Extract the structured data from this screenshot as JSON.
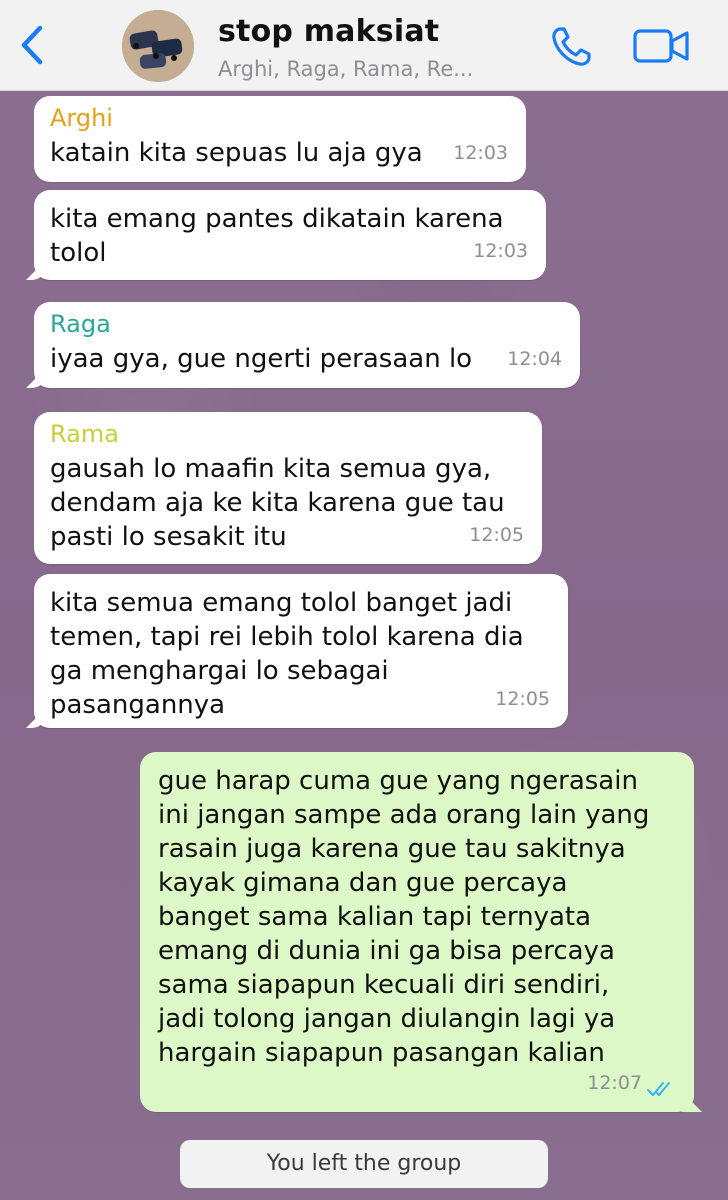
{
  "header": {
    "title": "stop maksiat",
    "subtitle": "Arghi, Raga, Rama, Re..."
  },
  "messages": [
    {
      "sender": "Arghi",
      "sender_color": "#e0a21a",
      "text": "katain kita sepuas lu aja gya",
      "time": "12:03",
      "direction": "in"
    },
    {
      "sender": "",
      "text": "kita emang pantes dikatain karena\ntolol",
      "time": "12:03",
      "direction": "in"
    },
    {
      "sender": "Raga",
      "sender_color": "#2aa59a",
      "text": "iyaa gya, gue ngerti perasaan lo",
      "time": "12:04",
      "direction": "in"
    },
    {
      "sender": "Rama",
      "sender_color": "#c7cf3c",
      "text": "gausah lo maafin kita semua gya,\ndendam aja ke kita karena gue tau\npasti lo sesakit itu",
      "time": "12:05",
      "direction": "in"
    },
    {
      "sender": "",
      "text": "kita semua emang tolol banget jadi\ntemen, tapi rei lebih tolol karena dia\nga menghargai lo sebagai\npasangannya",
      "time": "12:05",
      "direction": "in"
    },
    {
      "sender": "",
      "text": "gue harap cuma gue yang ngerasain\nini jangan sampe ada orang lain yang\nrasain juga karena gue tau sakitnya\nkayak gimana dan gue percaya\nbanget sama kalian tapi ternyata\nemang di dunia ini ga bisa percaya\nsama siapapun kecuali diri sendiri,\njadi tolong jangan diulangin lagi ya\nhargain siapapun pasangan kalian",
      "time": "12:07",
      "direction": "out",
      "status": "read"
    }
  ],
  "system_message": "You left the group",
  "colors": {
    "accent": "#1a7cf5",
    "outgoing_bubble": "#dcf8c6",
    "incoming_bubble": "#ffffff",
    "read_ticks": "#34b7f1"
  },
  "icons": {
    "back": "chevron-left-icon",
    "call": "phone-icon",
    "video": "video-camera-icon",
    "ticks": "double-check-icon"
  }
}
